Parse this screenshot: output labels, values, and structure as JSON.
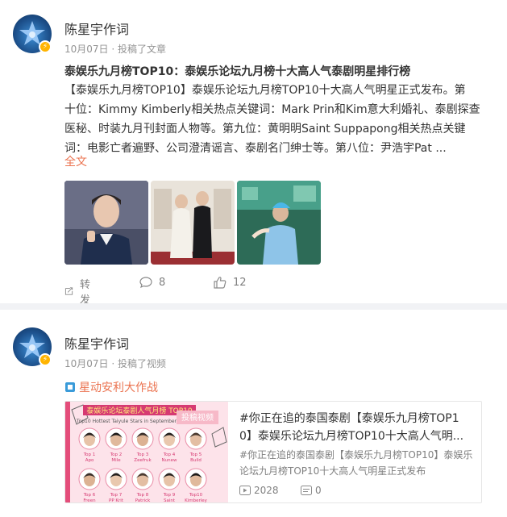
{
  "posts": [
    {
      "author": "陈星宇作词",
      "meta": "10月07日 · 投稿了文章",
      "title": "泰娱乐九月榜TOP10：泰娱乐论坛九月榜十大高人气泰剧明星排行榜",
      "body_lines": [
        "【泰娱乐九月榜TOP10】泰娱乐论坛九月榜TOP10十大高人气明星正式发布。第",
        "十位：Kimmy Kimberly相关热点关键词：Mark Prin和Kim意大利婚礼、泰剧探查",
        "医秘、时装九月刊封面人物等。第九位：黄明明Saint Suppapong相关热点关键",
        "词：电影亡者遍野、公司澄清谣言、泰剧名门绅士等。第八位：尹浩宇Pat ..."
      ],
      "full_text_link": "全文",
      "actions": {
        "repost": "转发",
        "comments": "8",
        "likes": "12"
      }
    },
    {
      "author": "陈星宇作词",
      "meta": "10月07日 · 投稿了视频",
      "topic": "星动安利大作战",
      "video": {
        "thumb_header": "泰娱乐论坛泰剧人气月榜 TOP10",
        "thumb_subheader": "Top10 Hottest Taiyule Stars in September",
        "thumb_badge": "投稿视频",
        "ranks_row1": [
          "Top 1 Apo",
          "Top 2 Mile",
          "Top 3 Zeefruk",
          "Top 4 Nunew",
          "Top 5 Build"
        ],
        "ranks_row2": [
          "Top 6 Freen",
          "Top 7 PP Krit",
          "Top 8 Patrick",
          "Top 9 Saint",
          "Top10 Kimberley"
        ],
        "title_lines": [
          "#你正在追的泰国泰剧【泰娱乐九月榜TOP1",
          "0】泰娱乐论坛九月榜TOP10十大高人气明..."
        ],
        "desc_lines": [
          "#你正在追的泰国泰剧【泰娱乐九月榜TOP10】泰娱乐",
          "论坛九月榜TOP10十大高人气明星正式发布"
        ],
        "plays": "2028",
        "danmaku": "0"
      }
    }
  ],
  "colors": {
    "accent": "#eb7350",
    "muted": "#939393",
    "separator": "#f1f2f5",
    "badge": "#ffb400"
  }
}
